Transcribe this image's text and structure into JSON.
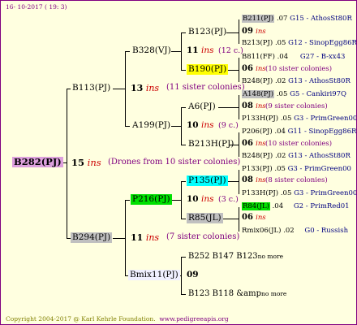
{
  "header": {
    "date": "16- 10-2017 ( 19: 3)"
  },
  "root": {
    "label": "B282(PJ)",
    "count": "15",
    "ins": "ins",
    "note": "(Drones from 10 sister colonies)",
    "color": "#dda0dd"
  },
  "branchTop": {
    "label": "B113(PJ)",
    "count": "13",
    "ins": "ins",
    "note": "(11 sister colonies)"
  },
  "branchBottom": {
    "label": "B294(PJ)",
    "count": "11",
    "ins": "ins",
    "note": "(7 sister colonies)",
    "color": "#c0c0c0"
  },
  "gen3": {
    "a": {
      "label": "B328(VJ)",
      "count": "11",
      "ins": "ins",
      "note": "(12 c.)"
    },
    "b": {
      "label": "A199(PJ)",
      "count": "10",
      "ins": "ins",
      "note": "(9 c.)"
    },
    "c": {
      "label": "P216(PJ)",
      "count": "10",
      "ins": "ins",
      "note": "(3 c.)",
      "color": "#00e000"
    },
    "d": {
      "label": "Bmix11(PJ)",
      "count": "09"
    }
  },
  "gen4": {
    "a1": {
      "label": "B123(PJ)",
      "count": "09",
      "ins": "ins"
    },
    "a2": {
      "label": "B190(PJ)",
      "count": "06",
      "ins": "ins",
      "note": "(10 sister colonies)",
      "color": "#ffff00"
    },
    "b1": {
      "label": "A6(PJ)",
      "count": "08",
      "ins": "ins",
      "note": "(9 sister colonies)"
    },
    "b2": {
      "label": "B213H(PJ)",
      "count": "06",
      "ins": "ins",
      "note": "(10 sister colonies)"
    },
    "c1": {
      "label": "P135(PJ)",
      "count": "08",
      "ins": "ins",
      "note": "(8 sister colonies)",
      "color": "#00ffff"
    },
    "c2": {
      "label": "R85(JL)",
      "count": "06",
      "ins": "ins",
      "color": "#c0c0c0"
    },
    "d1": {
      "label": "B252 B147 B123",
      "tail": "no more"
    },
    "d2": {
      "label": "B123 B118 &amp",
      "tail": "no more"
    }
  },
  "gen5": [
    {
      "name": "B211(PJ)",
      "year": ".07",
      "breeder": "G15 - AthosSt80R",
      "color": "#c0c0c0"
    },
    {
      "name": "B213(PJ)",
      "year": ".05",
      "breeder": "G12 - SinopEgg86R"
    },
    {
      "name": "B811(FF)",
      "year": ".04",
      "breeder": "G27 - B-xx43"
    },
    {
      "name": "B248(PJ)",
      "year": ".02",
      "breeder": "G13 - AthosSt80R"
    },
    {
      "name": "A148(PJ)",
      "year": ".05",
      "breeder": "G5 - Cankiri97Q",
      "color": "#c0c0c0"
    },
    {
      "name": "P133H(PJ)",
      "year": ".05",
      "breeder": "G3 - PrimGreen00"
    },
    {
      "name": "P206(PJ)",
      "year": ".04",
      "breeder": "G11 - SinopEgg86R"
    },
    {
      "name": "B248(PJ)",
      "year": ".02",
      "breeder": "G13 - AthosSt80R"
    },
    {
      "name": "P133(PJ)",
      "year": ".05",
      "breeder": "G3 - PrimGreen00"
    },
    {
      "name": "P133H(PJ)",
      "year": ".05",
      "breeder": "G3 - PrimGreen00"
    },
    {
      "name": "R84(JL)",
      "year": ".04",
      "breeder": "G2 - PrimRed01",
      "color": "#00e000"
    },
    {
      "name": "Rmix06(JL)",
      "year": ".02",
      "breeder": "G0 - Russish"
    }
  ],
  "footer": {
    "copyright": "Copyright 2004-2017 @ Karl Kehrle Foundation.",
    "site": "www.pedigreeapis.org"
  }
}
